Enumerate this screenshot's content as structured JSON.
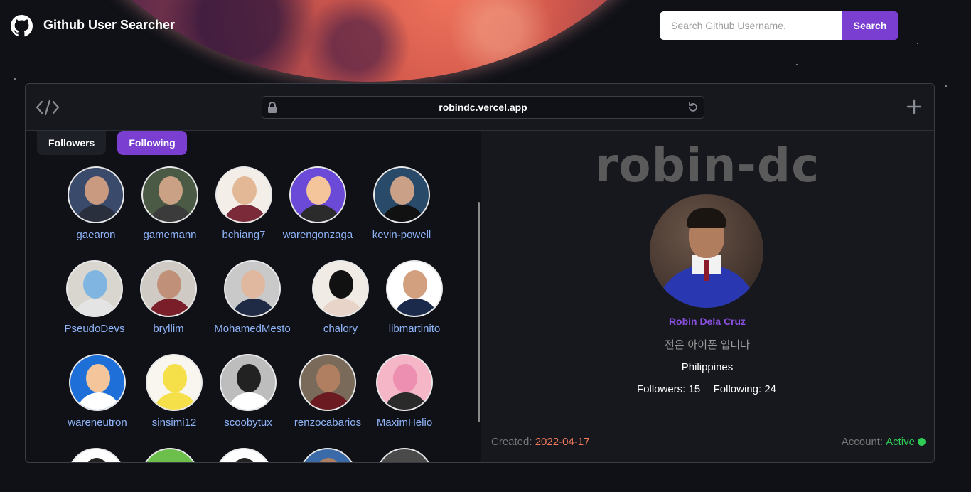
{
  "header": {
    "title": "Github User Searcher",
    "search_placeholder": "Search Github Username.",
    "search_value": "",
    "search_button": "Search"
  },
  "browser": {
    "url": "robindc.vercel.app"
  },
  "tabs": [
    {
      "label": "Followers",
      "active": false
    },
    {
      "label": "Following",
      "active": true
    }
  ],
  "following": [
    {
      "username": "gaearon"
    },
    {
      "username": "gamemann"
    },
    {
      "username": "bchiang7"
    },
    {
      "username": "warengonzaga"
    },
    {
      "username": "kevin-powell"
    },
    {
      "username": "PseudoDevs"
    },
    {
      "username": "bryllim"
    },
    {
      "username": "MohamedMesto"
    },
    {
      "username": "chalory"
    },
    {
      "username": "libmartinito"
    },
    {
      "username": "wareneutron"
    },
    {
      "username": "sinsimi12"
    },
    {
      "username": "scoobytux"
    },
    {
      "username": "renzocabarios"
    },
    {
      "username": "MaximHelio"
    }
  ],
  "profile": {
    "login": "robin-dc",
    "name": "Robin Dela Cruz",
    "bio": "전은 아이폰 입니다",
    "location": "Philippines",
    "followers_label": "Followers:",
    "followers": "15",
    "following_label": "Following:",
    "following": "24",
    "created_label": "Created:",
    "created": "2022-04-17",
    "account_label": "Account:",
    "account_status": "Active"
  },
  "colors": {
    "accent": "#7a3fd1",
    "link": "#8fb4f8",
    "created": "#f47a5a",
    "active": "#2ecc55"
  }
}
